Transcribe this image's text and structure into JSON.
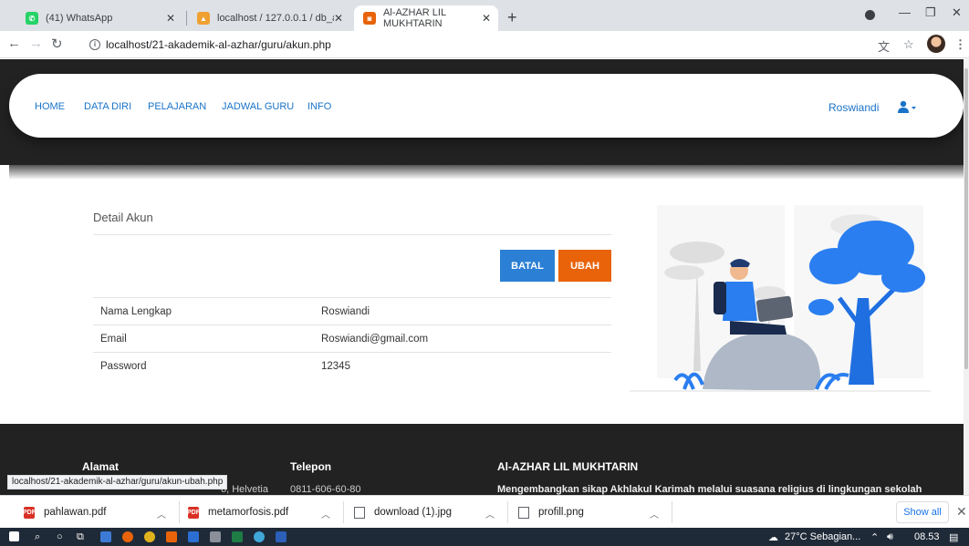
{
  "browser": {
    "tabs": [
      {
        "label": "(41) WhatsApp"
      },
      {
        "label": "localhost / 127.0.0.1 / db_akadem"
      },
      {
        "label": "Al-AZHAR LIL MUKHTARIN"
      }
    ],
    "url": "localhost/21-akademik-al-azhar/guru/akun.php",
    "status_url": "localhost/21-akademik-al-azhar/guru/akun-ubah.php"
  },
  "nav": {
    "links": [
      "HOME",
      "DATA DIRI",
      "PELAJARAN",
      "JADWAL GURU",
      "INFO"
    ],
    "user": "Roswiandi"
  },
  "detail": {
    "title": "Detail Akun",
    "batal_label": "BATAL",
    "ubah_label": "UBAH",
    "rows": [
      {
        "label": "Nama Lengkap",
        "value": "Roswiandi"
      },
      {
        "label": "Email",
        "value": "Roswiandi@gmail.com"
      },
      {
        "label": "Password",
        "value": "12345"
      }
    ]
  },
  "footer": {
    "col1_title": "Alamat",
    "col1_text": "6, Helvetia",
    "col2_title": "Telepon",
    "col2_text": "0811-606-60-80",
    "col3_title": "Al-AZHAR LIL MUKHTARIN",
    "col3_text": "Mengembangkan sikap Akhlakul Karimah melalui suasana religius di lingkungan sekolah"
  },
  "downloads": {
    "items": [
      {
        "name": "pahlawan.pdf",
        "type": "pdf"
      },
      {
        "name": "metamorfosis.pdf",
        "type": "pdf"
      },
      {
        "name": "download (1).jpg",
        "type": "img"
      },
      {
        "name": "profill.png",
        "type": "img"
      }
    ],
    "show_all": "Show all"
  },
  "taskbar": {
    "weather": "27°C  Sebagian...",
    "time": "08.53"
  },
  "colors": {
    "accent_blue": "#2b7fd4",
    "accent_orange": "#e8630a",
    "dark_band": "#222222"
  }
}
